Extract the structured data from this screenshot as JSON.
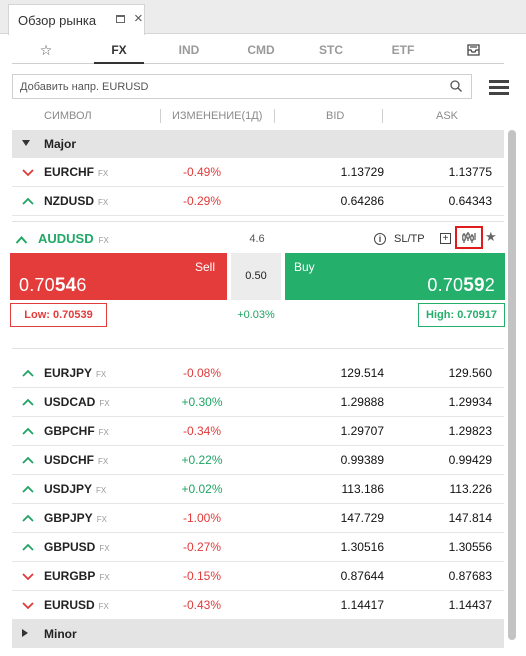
{
  "window": {
    "tab_title": "Обзор рынка",
    "tab_close": "×"
  },
  "categories": [
    "☆",
    "FX",
    "IND",
    "CMD",
    "STC",
    "ETF"
  ],
  "active_category": "FX",
  "search": {
    "placeholder": "Добавить напр. EURUSD"
  },
  "columns": {
    "symbol": "СИМВОЛ",
    "change": "ИЗМЕНЕНИЕ(1Д)",
    "bid": "BID",
    "ask": "ASK"
  },
  "groups": {
    "major": "Major",
    "minor": "Minor"
  },
  "asset_class": "FX",
  "colors": {
    "sell": "#e43b3b",
    "buy": "#24b06b",
    "negative": "#e03a3a",
    "positive": "#1fa463",
    "highlight": "#e01b1b"
  },
  "rows_top": [
    {
      "symbol": "EURCHF",
      "direction": "down",
      "change": "-0.49%",
      "bid": "1.13729",
      "ask": "1.13775"
    },
    {
      "symbol": "NZDUSD",
      "direction": "up",
      "change": "-0.29%",
      "bid": "0.64286",
      "ask": "0.64343"
    }
  ],
  "expanded": {
    "symbol": "AUDUSD",
    "spread_top": "4.6",
    "sltp_label": "SL/TP",
    "sell_label": "Sell",
    "sell_price_start": "0.70",
    "sell_price_big": "54",
    "sell_price_end": "6",
    "spread": "0.50",
    "buy_label": "Buy",
    "buy_price_start": "0.70",
    "buy_price_big": "59",
    "buy_price_end": "2",
    "low": "Low: 0.70539",
    "high": "High: 0.70917",
    "change": "+0.03%"
  },
  "rows_bottom": [
    {
      "symbol": "EURJPY",
      "direction": "up",
      "change": "-0.08%",
      "bid": "129.514",
      "ask": "129.560"
    },
    {
      "symbol": "USDCAD",
      "direction": "up",
      "change": "+0.30%",
      "bid": "1.29888",
      "ask": "1.29934"
    },
    {
      "symbol": "GBPCHF",
      "direction": "up",
      "change": "-0.34%",
      "bid": "1.29707",
      "ask": "1.29823"
    },
    {
      "symbol": "USDCHF",
      "direction": "up",
      "change": "+0.22%",
      "bid": "0.99389",
      "ask": "0.99429"
    },
    {
      "symbol": "USDJPY",
      "direction": "up",
      "change": "+0.02%",
      "bid": "113.186",
      "ask": "113.226"
    },
    {
      "symbol": "GBPJPY",
      "direction": "up",
      "change": "-1.00%",
      "bid": "147.729",
      "ask": "147.814"
    },
    {
      "symbol": "GBPUSD",
      "direction": "up",
      "change": "-0.27%",
      "bid": "1.30516",
      "ask": "1.30556"
    },
    {
      "symbol": "EURGBP",
      "direction": "down",
      "change": "-0.15%",
      "bid": "0.87644",
      "ask": "0.87683"
    },
    {
      "symbol": "EURUSD",
      "direction": "down",
      "change": "-0.43%",
      "bid": "1.14417",
      "ask": "1.14437"
    }
  ]
}
